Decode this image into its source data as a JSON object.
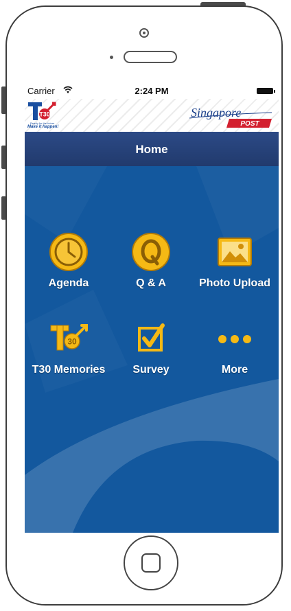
{
  "status_bar": {
    "carrier": "Carrier",
    "time": "2:24 PM"
  },
  "brand": {
    "left_logo_text": "T30",
    "left_logo_tagline": "Ready for the future",
    "left_logo_slogan": "Make it happen!",
    "right_logo_script": "Singapore",
    "right_logo_word": "POST"
  },
  "nav": {
    "title": "Home"
  },
  "menu": [
    {
      "label": "Agenda",
      "icon": "clock-icon"
    },
    {
      "label": "Q & A",
      "icon": "q-icon"
    },
    {
      "label": "Photo Upload",
      "icon": "photo-icon"
    },
    {
      "label": "T30 Memories",
      "icon": "t30-icon"
    },
    {
      "label": "Survey",
      "icon": "checkbox-icon"
    },
    {
      "label": "More",
      "icon": "more-dots-icon"
    }
  ],
  "colors": {
    "accent_gold": "#f5b915",
    "content_blue": "#13589e",
    "nav_blue": "#243f75",
    "post_red": "#d3202f"
  }
}
